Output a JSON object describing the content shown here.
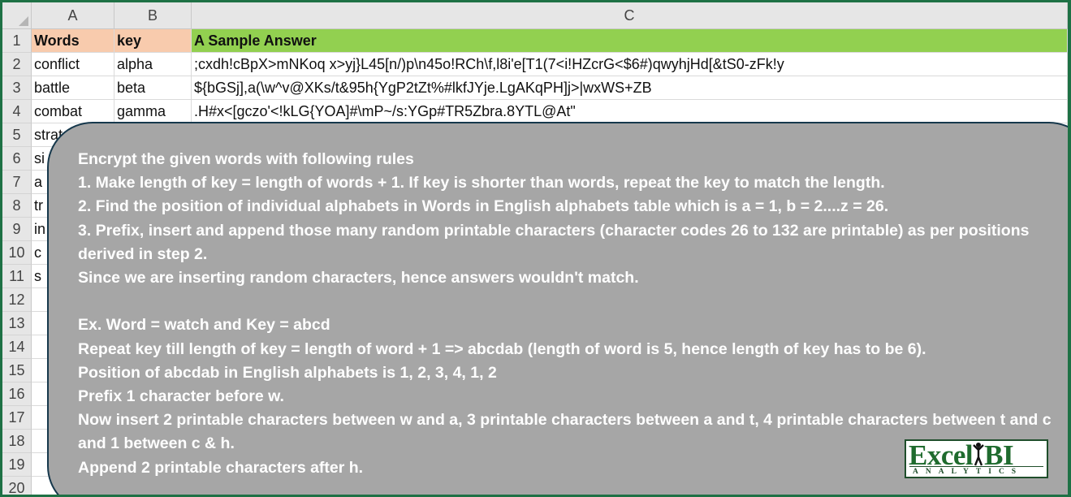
{
  "columns": [
    "A",
    "B",
    "C"
  ],
  "row_numbers": [
    "1",
    "2",
    "3",
    "4",
    "5",
    "6",
    "7",
    "8",
    "9",
    "10",
    "11",
    "12",
    "13",
    "14",
    "15",
    "16",
    "17",
    "18",
    "19",
    "20"
  ],
  "headers": {
    "words": "Words",
    "key": "key",
    "answer": "A Sample Answer"
  },
  "rows": [
    {
      "word": "conflict",
      "key": "alpha",
      "answer": ";cxdh!cBpX>mNKoq x>yj}L45[n/)p\\n45o!RCh\\f,l8i'e[T1(7<i!HZcrG<$6#)qwyhjHd[&tS0-zFk!y"
    },
    {
      "word": "battle",
      "key": "beta",
      "answer": "${bGSj],a(\\w^v@XKs/t&95h{YgP2tZt%#lkfJYje.LgAKqPH]j>|wxWS+ZB"
    },
    {
      "word": "combat",
      "key": "gamma",
      "answer": ".H#x<[gczo'<!kLG{YOA]#\\mP~/s:YGp#TR5Zbra.8YTL@At\""
    },
    {
      "word": "strat",
      "key": "",
      "answer": ""
    },
    {
      "word": "si",
      "key": "",
      "answer": ""
    },
    {
      "word": "a",
      "key": "",
      "answer": ""
    },
    {
      "word": "tr",
      "key": "",
      "answer": ""
    },
    {
      "word": "in",
      "key": "",
      "answer": ""
    },
    {
      "word": "c",
      "key": "",
      "answer": ""
    },
    {
      "word": "s",
      "key": "",
      "answer": ""
    }
  ],
  "instructions": [
    "Encrypt the given words with following rules",
    "1. Make length of key = length of words + 1. If key is shorter than words, repeat the key to match the length.",
    "2. Find the position of individual alphabets in Words in English alphabets table which is a = 1, b = 2....z = 26.",
    "3. Prefix, insert and append those many random printable characters (character codes 26 to 132 are printable) as per positions derived in step 2.",
    "Since we are inserting random characters, hence answers wouldn't match.",
    "",
    "Ex. Word = watch and Key = abcd",
    "Repeat key till length of key = length of word + 1 => abcdab (length of word is 5, hence length of key has to be 6).",
    "Position of abcdab in English alphabets is 1, 2, 3, 4, 1, 2",
    "Prefix 1 character before w.",
    "Now insert 2 printable characters between w and a, 3 printable characters between a and t, 4 printable characters between t and c and 1 between c & h.",
    "Append 2 printable characters after h."
  ],
  "logo": {
    "word_excel": "Excel",
    "word_bi": "BI",
    "subtitle": "ANALYTICS"
  },
  "colors": {
    "header_ab": "#f8cbad",
    "header_c": "#92d050",
    "overlay": "#a6a6a6",
    "frame": "#1e7145"
  }
}
